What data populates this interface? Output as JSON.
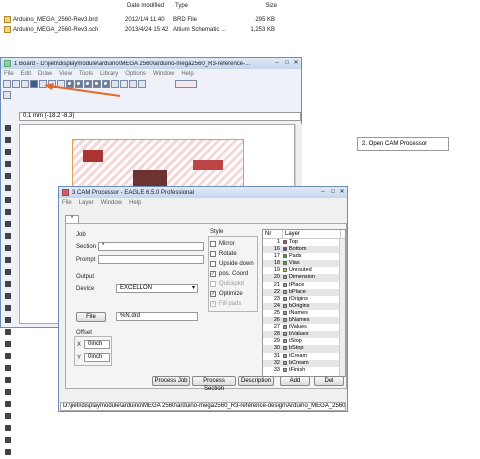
{
  "explorer": {
    "headers": {
      "date": "Date modified",
      "type": "Type",
      "size": "Size"
    },
    "files": [
      {
        "name": "Arduino_MEGA_2560-Rev3.brd",
        "date": "2012/1/4 11:40",
        "type": "BRD File",
        "size": "295 KB"
      },
      {
        "name": "Arduino_MEGA_2560-Rev3.sch",
        "date": "2013/4/24 15:42",
        "type": "Altium Schematic ...",
        "size": "1,253 KB"
      }
    ]
  },
  "board_window": {
    "title": "1 Board - D:\\jieti\\displaymodule\\arduino\\MEGA 2560\\arduino-mega2560_R3-reference-...",
    "menu": [
      "File",
      "Edit",
      "Draw",
      "View",
      "Tools",
      "Library",
      "Options",
      "Window",
      "Help"
    ],
    "coord_readout": "0.1 mm (-18.2 -8.3)"
  },
  "annotation": {
    "text": "2. Open CAM Processor"
  },
  "cam_window": {
    "title": "3 CAM Processor - EAGLE 6.5.0 Professional",
    "menu": [
      "File",
      "Layer",
      "Window",
      "Help"
    ],
    "tab": "*",
    "job": {
      "heading": "Job",
      "section_label": "Section",
      "section_value": "*",
      "prompt_label": "Prompt",
      "prompt_value": ""
    },
    "output": {
      "heading": "Output",
      "device_label": "Device",
      "device_value": "EXCELLON",
      "file_button": "File",
      "file_value": "%N.drd"
    },
    "offset": {
      "heading": "Offset",
      "x_label": "X",
      "x_value": "0inch",
      "y_label": "Y",
      "y_value": "0inch"
    },
    "style": {
      "heading": "Style",
      "options": [
        {
          "label": "Mirror",
          "checked": false,
          "disabled": false
        },
        {
          "label": "Rotate",
          "checked": false,
          "disabled": false
        },
        {
          "label": "Upside down",
          "checked": false,
          "disabled": false
        },
        {
          "label": "pos. Coord",
          "checked": true,
          "disabled": false
        },
        {
          "label": "Quickplot",
          "checked": false,
          "disabled": true
        },
        {
          "label": "Optimize",
          "checked": true,
          "disabled": false
        },
        {
          "label": "Fill pads",
          "checked": true,
          "disabled": true
        }
      ]
    },
    "layers_header": {
      "nr": "Nr",
      "layer": "Layer"
    },
    "layers": [
      {
        "nr": "1",
        "name": "Top",
        "color": "#c44"
      },
      {
        "nr": "16",
        "name": "Bottom",
        "color": "#44c"
      },
      {
        "nr": "17",
        "name": "Pads",
        "color": "#4a4"
      },
      {
        "nr": "18",
        "name": "Vias",
        "color": "#4a4"
      },
      {
        "nr": "19",
        "name": "Unrouted",
        "color": "#cc4"
      },
      {
        "nr": "20",
        "name": "Dimension",
        "color": "#999"
      },
      {
        "nr": "21",
        "name": "tPlace",
        "color": "#999"
      },
      {
        "nr": "22",
        "name": "bPlace",
        "color": "#999"
      },
      {
        "nr": "23",
        "name": "tOrigins",
        "color": "#999"
      },
      {
        "nr": "24",
        "name": "bOrigins",
        "color": "#999"
      },
      {
        "nr": "25",
        "name": "tNames",
        "color": "#999"
      },
      {
        "nr": "26",
        "name": "bNames",
        "color": "#999"
      },
      {
        "nr": "27",
        "name": "tValues",
        "color": "#999"
      },
      {
        "nr": "28",
        "name": "bValues",
        "color": "#999"
      },
      {
        "nr": "29",
        "name": "tStop",
        "color": "#999"
      },
      {
        "nr": "30",
        "name": "bStop",
        "color": "#999"
      },
      {
        "nr": "31",
        "name": "tCream",
        "color": "#999"
      },
      {
        "nr": "32",
        "name": "bCream",
        "color": "#999"
      },
      {
        "nr": "33",
        "name": "tFinish",
        "color": "#999"
      }
    ],
    "buttons": {
      "process_job": "Process Job",
      "process_section": "Process Section",
      "description": "Description",
      "add": "Add",
      "del": "Del"
    },
    "status_path": "D:\\jieti\\displaymodule\\arduino\\MEGA 2560\\arduino-mega2560_R3-reference-design\\Arduino_MEGA_2560-Re"
  },
  "colors": {
    "arrow": "#e36a2d",
    "pcb_trace": "#d33",
    "title_bar": "#c4d5ec"
  }
}
